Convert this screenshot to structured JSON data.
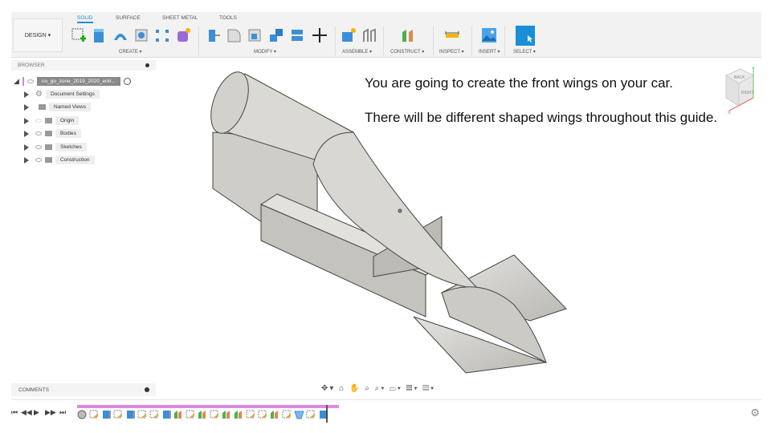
{
  "toolbar": {
    "design": "DESIGN ▾",
    "tabs": [
      "SOLID",
      "SURFACE",
      "SHEET METAL",
      "TOOLS"
    ],
    "groups": [
      "CREATE ▾",
      "MODIFY ▾",
      "ASSEMBLE ▾",
      "CONSTRUCT ▾",
      "INSPECT ▾",
      "INSERT ▾",
      "SELECT ▾"
    ]
  },
  "browser": {
    "title": "BROWSER",
    "root": "no_go_zone_2019_2020_entr...",
    "items": [
      "Document Settings",
      "Named Views",
      "Origin",
      "Bodies",
      "Sketches",
      "Construction"
    ]
  },
  "comments": {
    "title": "COMMENTS"
  },
  "navbar": {
    "icons": "✥▾ ⌂ ✋ ⌕ ⌕▾ ▭▾ ▦▾ ▤▾"
  },
  "timeline": {
    "controls": [
      "⏮",
      "◀◀",
      "▶",
      "▶▶",
      "⏭"
    ],
    "items": [
      "body",
      "sketch",
      "extrude",
      "sketch",
      "extrude",
      "sketch",
      "sketch",
      "extrude",
      "plane",
      "sketch",
      "plane",
      "sketch",
      "plane",
      "plane",
      "sketch",
      "sketch",
      "plane",
      "sketch",
      "loft",
      "sketch",
      "extrude"
    ]
  },
  "viewcube": {
    "faces": [
      "BACK",
      "RIGHT"
    ],
    "axes": [
      "X",
      "Y",
      "Z"
    ]
  },
  "note": {
    "line1": "You are going to create the front wings on your car.",
    "line2": "There will be different shaped wings throughout this guide."
  },
  "colors": {
    "accent": "#1a8fd8",
    "timeline": "#dc8ae0"
  }
}
